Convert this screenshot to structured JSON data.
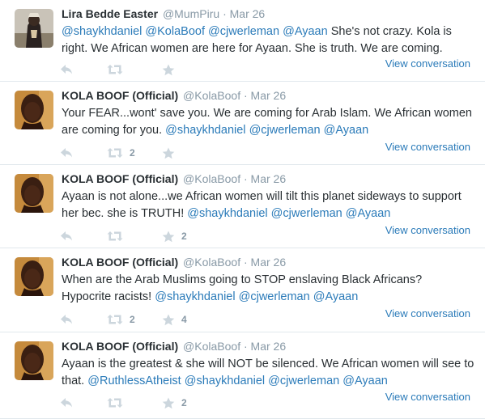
{
  "colors": {
    "link": "#2b7bb9",
    "muted": "#8899a6",
    "text": "#292f33",
    "icon": "#ccd6dd",
    "divider": "#e1e8ed"
  },
  "view_conversation_label": "View conversation",
  "tweets": [
    {
      "fullname": "Lira Bedde Easter",
      "username": "@MumPiru",
      "separator": "·",
      "time": "Mar 26",
      "segments": [
        {
          "t": "@shaykhdaniel",
          "m": true
        },
        {
          "t": " ",
          "m": false
        },
        {
          "t": "@KolaBoof",
          "m": true
        },
        {
          "t": " ",
          "m": false
        },
        {
          "t": "@cjwerleman",
          "m": true
        },
        {
          "t": " ",
          "m": false
        },
        {
          "t": "@Ayaan",
          "m": true
        },
        {
          "t": " She's not crazy. Kola is right. We African women are here for Ayaan. She is truth. We are coming.",
          "m": false
        }
      ],
      "retweets": "",
      "favorites": "",
      "avatar": "lira"
    },
    {
      "fullname": "KOLA BOOF (Official)",
      "username": "@KolaBoof",
      "separator": "·",
      "time": "Mar 26",
      "segments": [
        {
          "t": "Your FEAR...wont' save you. We are coming for Arab Islam. We African women are coming for you. ",
          "m": false
        },
        {
          "t": "@shaykhdaniel",
          "m": true
        },
        {
          "t": " ",
          "m": false
        },
        {
          "t": "@cjwerleman",
          "m": true
        },
        {
          "t": " ",
          "m": false
        },
        {
          "t": "@Ayaan",
          "m": true
        }
      ],
      "retweets": "2",
      "favorites": "",
      "avatar": "kola"
    },
    {
      "fullname": "KOLA BOOF (Official)",
      "username": "@KolaBoof",
      "separator": "·",
      "time": "Mar 26",
      "segments": [
        {
          "t": "Ayaan is not alone...we African women will tilt this planet sideways to support her bec. she is TRUTH! ",
          "m": false
        },
        {
          "t": "@shaykhdaniel",
          "m": true
        },
        {
          "t": " ",
          "m": false
        },
        {
          "t": "@cjwerleman",
          "m": true
        },
        {
          "t": " ",
          "m": false
        },
        {
          "t": "@Ayaan",
          "m": true
        }
      ],
      "retweets": "",
      "favorites": "2",
      "avatar": "kola"
    },
    {
      "fullname": "KOLA BOOF (Official)",
      "username": "@KolaBoof",
      "separator": "·",
      "time": "Mar 26",
      "segments": [
        {
          "t": "When are the Arab Muslims going to STOP enslaving Black Africans? Hypocrite racists! ",
          "m": false
        },
        {
          "t": "@shaykhdaniel",
          "m": true
        },
        {
          "t": " ",
          "m": false
        },
        {
          "t": "@cjwerleman",
          "m": true
        },
        {
          "t": " ",
          "m": false
        },
        {
          "t": "@Ayaan",
          "m": true
        }
      ],
      "retweets": "2",
      "favorites": "4",
      "avatar": "kola"
    },
    {
      "fullname": "KOLA BOOF (Official)",
      "username": "@KolaBoof",
      "separator": "·",
      "time": "Mar 26",
      "segments": [
        {
          "t": "Ayaan is the greatest & she will NOT be silenced. We African women will see to that. ",
          "m": false
        },
        {
          "t": "@RuthlessAtheist",
          "m": true
        },
        {
          "t": " ",
          "m": false
        },
        {
          "t": "@shaykhdaniel",
          "m": true
        },
        {
          "t": " ",
          "m": false
        },
        {
          "t": "@cjwerleman",
          "m": true
        },
        {
          "t": " ",
          "m": false
        },
        {
          "t": "@Ayaan",
          "m": true
        }
      ],
      "retweets": "",
      "favorites": "2",
      "avatar": "kola"
    }
  ]
}
